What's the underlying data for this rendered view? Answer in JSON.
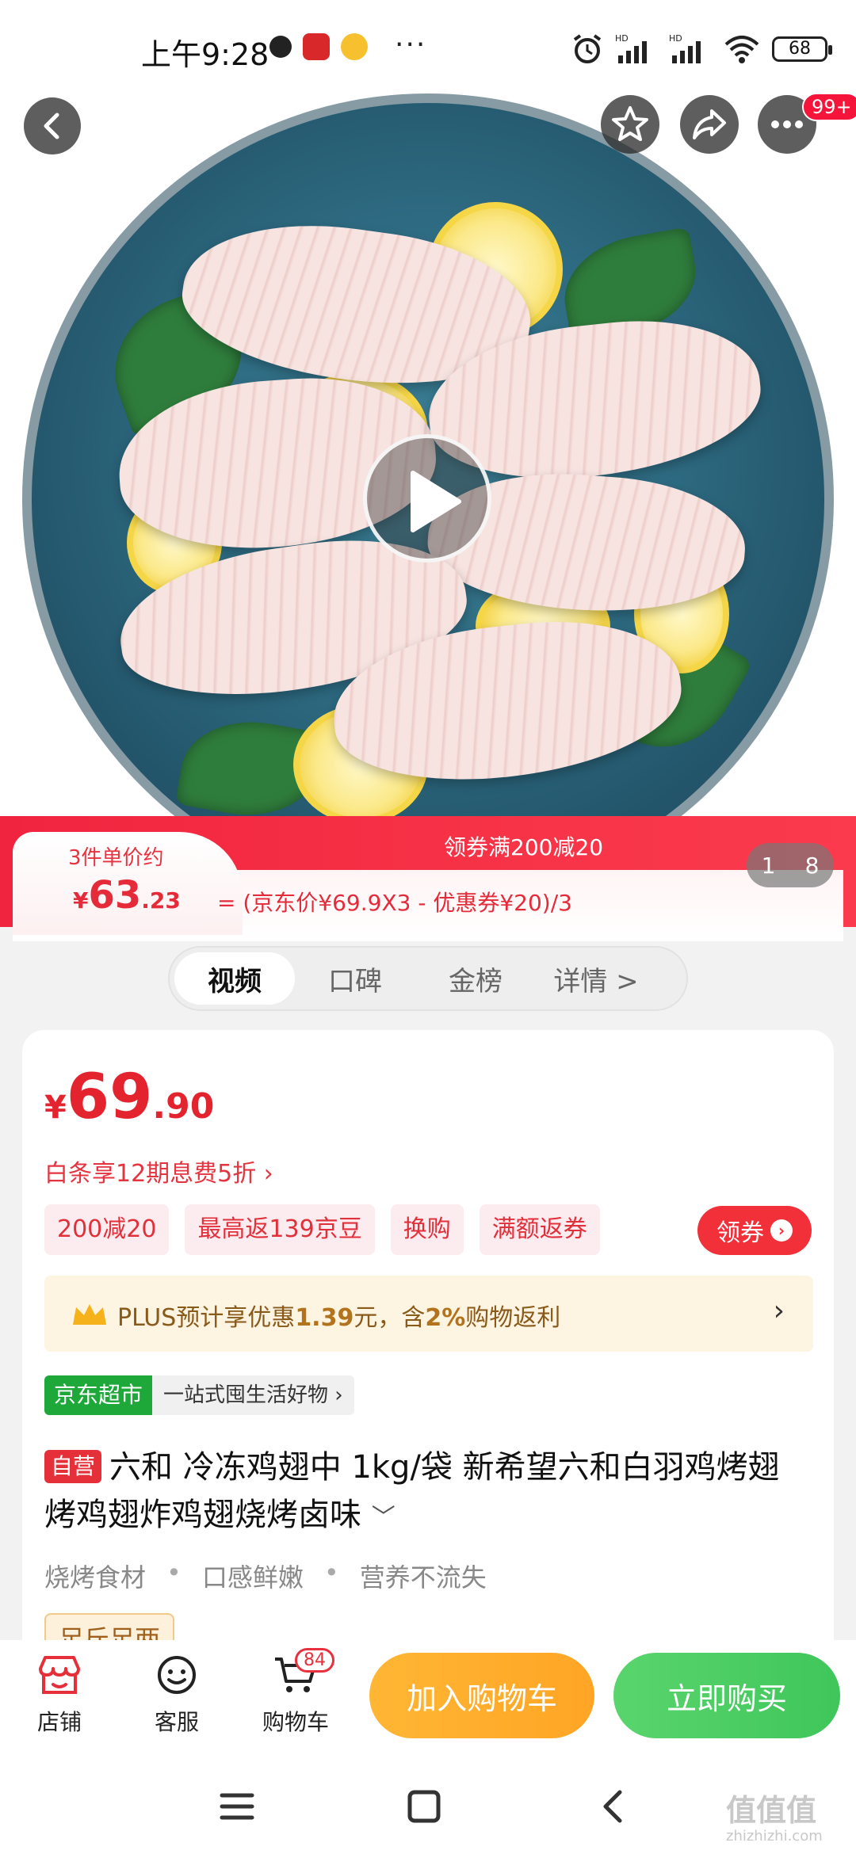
{
  "status_bar": {
    "time": "上午9:28",
    "overflow": "···",
    "battery": "68"
  },
  "colors": {
    "brand_red": "#e3242f",
    "cart_orange": "#ffa525",
    "buy_green": "#3fc65a",
    "jd_green": "#1fa83a"
  },
  "top_bar": {
    "more_badge": "99+"
  },
  "banner": {
    "tab_title": "3件单价约",
    "unit_price_symbol": "¥",
    "unit_price_int": "63",
    "unit_price_dec": ".23",
    "coupon_text": "领券满200减20",
    "formula": "= (京东价¥69.9X3 - 优惠券¥20)/3"
  },
  "gallery": {
    "current": "1",
    "total": "8"
  },
  "tabs": [
    {
      "label": "视频",
      "active": true
    },
    {
      "label": "口碑",
      "active": false
    },
    {
      "label": "金榜",
      "active": false
    },
    {
      "label": "详情 >",
      "active": false
    }
  ],
  "price": {
    "symbol": "¥",
    "int": "69",
    "dec": ".90"
  },
  "baitiao": "白条享12期息费5折 ›",
  "promos": [
    "200减20",
    "最高返139京豆",
    "换购",
    "满额返券"
  ],
  "coupon_button": "领券",
  "plus": {
    "prefix": "PLUS预计享优惠",
    "amount": "1.39",
    "middle": "元，含",
    "percent": "2%",
    "suffix": "购物返利",
    "arrow": "›"
  },
  "store": {
    "tag": "京东超市",
    "slogan": "一站式囤生活好物 ›"
  },
  "product": {
    "self_tag": "自营",
    "title": "六和  冷冻鸡翅中 1kg/袋 新希望六和白羽鸡烤翅烤鸡翅炸鸡翅烧烤卤味",
    "expand": "﹀",
    "features": [
      "烧烤食材",
      "口感鲜嫩",
      "营养不流失"
    ],
    "partial_tag": "足斤足两"
  },
  "bottom_bar": {
    "shop": "店铺",
    "service": "客服",
    "cart": "购物车",
    "cart_count": "84",
    "add_to_cart": "加入购物车",
    "buy_now": "立即购买"
  },
  "watermark": {
    "main": "值值值",
    "sub": "zhizhizhi.com"
  }
}
